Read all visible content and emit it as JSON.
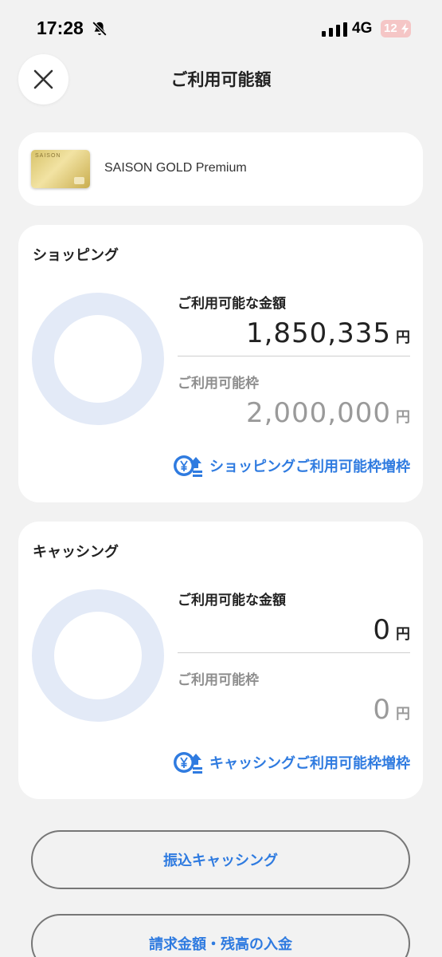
{
  "status_bar": {
    "time": "17:28",
    "network": "4G",
    "battery": "12",
    "icons": [
      "bell-slash-icon",
      "signal-icon",
      "battery-charging-icon"
    ]
  },
  "header": {
    "title": "ご利用可能額",
    "close_icon": "close-icon"
  },
  "card": {
    "brand_on_card": "SAISON",
    "name": "SAISON GOLD Premium"
  },
  "shopping": {
    "title": "ショッピング",
    "available_label": "ご利用可能な金額",
    "available_amount": "1,850,335",
    "limit_label": "ご利用可能枠",
    "limit_amount": "2,000,000",
    "currency": "円",
    "used_fraction": 0.075,
    "increase_label": "ショッピングご利用可能枠増枠"
  },
  "cashing": {
    "title": "キャッシング",
    "available_label": "ご利用可能な金額",
    "available_amount": "0",
    "limit_label": "ご利用可能枠",
    "limit_amount": "0",
    "currency": "円",
    "increase_label": "キャッシングご利用可能枠増枠"
  },
  "actions": {
    "transfer_label": "振込キャッシング",
    "payment_label": "請求金額・残高の入金"
  },
  "colors": {
    "accent": "#2f7be0",
    "donut_fill": "#2f7be0",
    "donut_remaining": "#e3eaf7",
    "background": "#f2f2f2"
  }
}
